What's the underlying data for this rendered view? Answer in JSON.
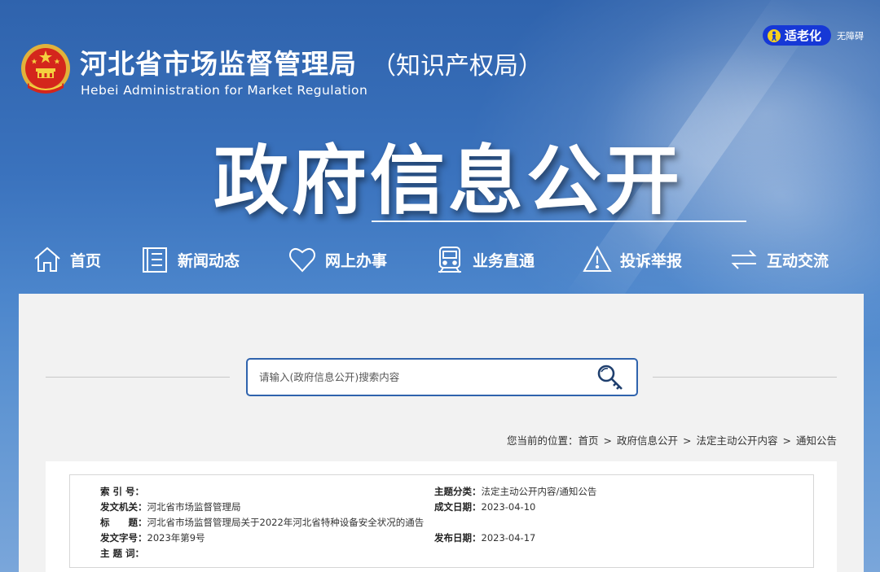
{
  "header": {
    "site_title": "河北省市场监督管理局",
    "site_title_sub": "（知识产权局）",
    "site_title_en": "Hebei Administration for Market Regulation",
    "elder_mode_label": "适老化",
    "accessibility_label": "无障碍",
    "hero_title": "政府信息公开"
  },
  "nav": {
    "items": [
      {
        "label": "首页",
        "icon": "home-icon"
      },
      {
        "label": "新闻动态",
        "icon": "news-icon"
      },
      {
        "label": "网上办事",
        "icon": "heart-icon"
      },
      {
        "label": "业务直通",
        "icon": "train-icon"
      },
      {
        "label": "投诉举报",
        "icon": "warning-icon"
      },
      {
        "label": "互动交流",
        "icon": "exchange-icon"
      }
    ]
  },
  "search": {
    "placeholder": "请输入(政府信息公开)搜索内容"
  },
  "breadcrumb": {
    "prefix": "您当前的位置：",
    "items": [
      "首页",
      "政府信息公开",
      "法定主动公开内容",
      "通知公告"
    ],
    "separator": ">"
  },
  "document_info": {
    "index_label": "索 引 号：",
    "index_value": "",
    "category_label": "主题分类：",
    "category_value": "法定主动公开内容/通知公告",
    "issuer_label": "发文机关：",
    "issuer_value": "河北省市场监督管理局",
    "written_date_label": "成文日期：",
    "written_date_value": "2023-04-10",
    "title_label": "标　　题：",
    "title_value": "河北省市场监督管理局关于2022年河北省特种设备安全状况的通告",
    "doc_number_label": "发文字号：",
    "doc_number_value": "2023年第9号",
    "publish_date_label": "发布日期：",
    "publish_date_value": "2023-04-17",
    "keywords_label": "主 题 词：",
    "keywords_value": ""
  },
  "colors": {
    "brand_blue": "#2f63ad",
    "elder_button": "#1638d6",
    "panel_bg": "#f2f2f2"
  }
}
